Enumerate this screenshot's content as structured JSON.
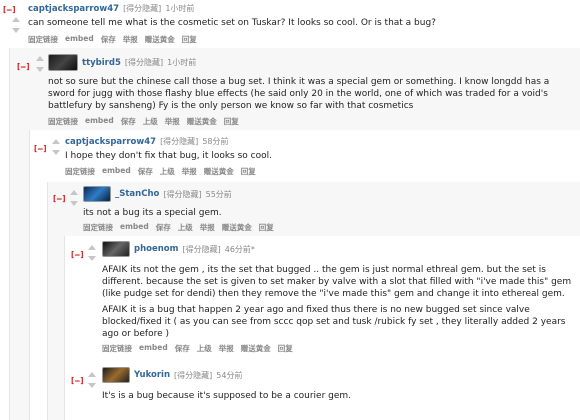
{
  "common": {
    "toggle": "[–]",
    "score": "[得分隐藏]",
    "buttons": [
      "固定链接",
      "embed",
      "保存",
      "举报",
      "赠送黄金",
      "回复"
    ],
    "buttons_parent": [
      "固定链接",
      "embed",
      "保存",
      "上级",
      "举报",
      "赠送黄金",
      "回复"
    ]
  },
  "comments": [
    {
      "author": "captjacksparrow47",
      "time": "1小时前",
      "body": "can someone tell me what is the cosmetic set on Tuskar? It looks so cool. Or is that a bug?"
    },
    {
      "author": "ttybird5",
      "time": "1小时前",
      "body": "not so sure but the chinese call those a bug set. I think it was a special gem or something. I know longdd has a sword for jugg with those flashy blue effects (he said only 20 in the world, one of which was traded for a void's battlefury by sansheng) Fy is the only person we know so far with that cosmetics"
    },
    {
      "author": "captjacksparrow47",
      "time": "58分前",
      "body": "I hope they don't fix that bug, it looks so cool."
    },
    {
      "author": "_StanCho",
      "time": "55分前",
      "body": "its not a bug its a special gem."
    },
    {
      "author": "phoenom",
      "time": "46分前*",
      "body1": "AFAIK its not the gem , its the set that bugged .. the gem is just normal ethreal gem. but the set is different. because the set is given to set maker by valve with a slot that filled with \"i've made this\" gem (like pudge set for dendi) then they remove the \"i've made this\" gem and change it into ethereal gem.",
      "body2": "AFAIK it is a bug that happen 2 year ago and fixed thus there is no new bugged set since valve blocked/fixed it ( as you can see from sccc qop set and tusk /rubick fy set , they literally added 2 years ago or before )"
    },
    {
      "author": "Yukorin",
      "time": "54分前",
      "body": "It's is a bug because it's supposed to be a courier gem."
    }
  ],
  "colors": {
    "author": "#336699",
    "toggle": "#cc0000",
    "meta": "#888888"
  }
}
